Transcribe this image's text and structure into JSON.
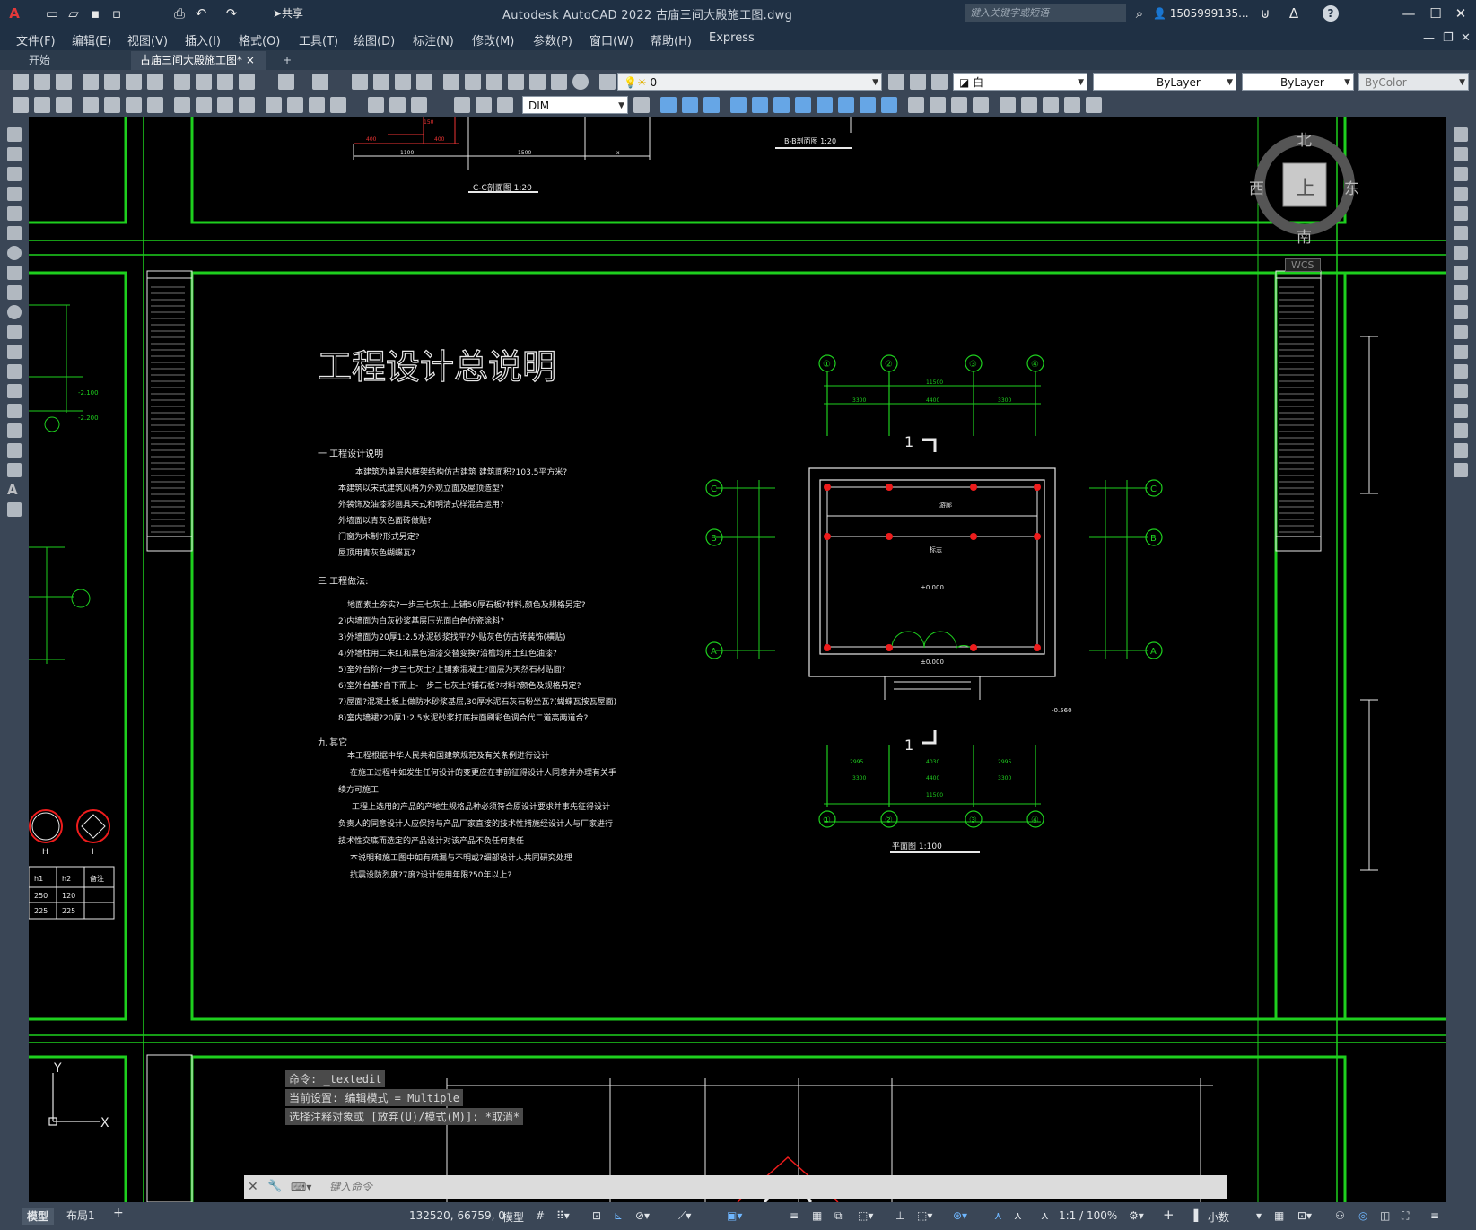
{
  "app": {
    "title": "Autodesk AutoCAD 2022    古庙三间大殿施工图.dwg",
    "share_label": "共享",
    "search_placeholder": "键入关键字或短语",
    "user": "1505999135...",
    "help": "?"
  },
  "menu": [
    "文件(F)",
    "编辑(E)",
    "视图(V)",
    "插入(I)",
    "格式(O)",
    "工具(T)",
    "绘图(D)",
    "标注(N)",
    "修改(M)",
    "参数(P)",
    "窗口(W)",
    "帮助(H)",
    "Express"
  ],
  "tabs": {
    "start": "开始",
    "active": "古庙三间大殿施工图*",
    "close": "×",
    "new": "+"
  },
  "toolbar": {
    "layer_value": "0",
    "color_value": "白",
    "linetype_value": "ByLayer",
    "lineweight_value": "ByLayer",
    "plotstyle_value": "ByColor",
    "dimstyle_value": "DIM"
  },
  "viewcube": {
    "north": "北",
    "south": "南",
    "east": "东",
    "west": "西",
    "top": "上",
    "wcs": "WCS"
  },
  "drawing": {
    "main_title": "工程设计总说明",
    "section1_head": "一 工程设计说明",
    "section1_lines": [
      "本建筑为单层内框架结构仿古建筑 建筑面积?103.5平方米?",
      "本建筑以宋式建筑风格为外观立面及屋顶造型?",
      "外装饰及油漆彩画具宋式和明清式样混合运用?",
      "外墙面以青灰色面砖做贴?",
      "门窗为木制?形式另定?",
      "屋顶用青灰色蝴蝶瓦?"
    ],
    "section2_head": "三 工程做法:",
    "section2_lines": [
      "地面素土夯实?一步三七灰土,上铺50厚石板?材料,颜色及规格另定?",
      "2)内墙面为白灰砂浆基层压光面白色仿瓷涂料?",
      "3)外墙面为20厚1:2.5水泥砂浆找平?外贴灰色仿古砖装饰(横贴)",
      "4)外墙柱用二朱红和黑色油漆交替变换?沿檐均用土红色油漆?",
      "5)室外台阶?一步三七灰土?上铺素混凝土?面层为天然石材贴面?",
      "6)室外台基?自下而上-一步三七灰土?铺石板?材料?颜色及规格另定?",
      "7)屋面?混凝土板上做防水砂浆基层,30厚水泥石灰石粉坐瓦?(蝴蝶瓦按瓦屋面)",
      "8)室内墙裙?20厚1:2.5水泥砂浆打底抹面刷彩色调合代二道高两道合?"
    ],
    "section3_head": "九 其它",
    "section3_lines": [
      "本工程根据中华人民共和国建筑规范及有关条例进行设计",
      "在施工过程中如发生任何设计的变更应在事前征得设计人同意并办理有关手",
      "续方可施工",
      "工程上选用的产品的产地生规格品种必须符合原设计要求并事先征得设计",
      "负责人的同意设计人应保持与产品厂家直接的技术性措施经设计人与厂家进行",
      "技术性交底而选定的产品设计对该产品不负任何责任",
      "本说明和施工图中如有疏漏与不明或?细部设计人共同研究处理",
      "抗震设防烈度?7度?设计使用年限?50年以上?"
    ],
    "section_cc": "C-C剖面图 1:20",
    "section_bb": "B-B剖面图 1:20",
    "plan_label": "平面图 1:100",
    "grid_top": [
      "①",
      "②",
      "③",
      "④"
    ],
    "grid_side": [
      "C",
      "B",
      "A"
    ],
    "dims_top": [
      "11500",
      "3300",
      "4400",
      "3300"
    ],
    "dims_bottom": [
      "2995",
      "4030",
      "2995",
      "3300",
      "4400",
      "3300",
      "11500"
    ],
    "elev": [
      "±0.000",
      "±0.000",
      "-0.560",
      "-2.100",
      "-2.200"
    ],
    "table": {
      "headers": [
        "h1",
        "h2",
        "备注"
      ],
      "rows": [
        [
          "250",
          "120",
          ""
        ],
        [
          "225",
          "225",
          ""
        ]
      ]
    },
    "circle_labels": [
      "H",
      "I"
    ],
    "section_marker": "1",
    "dims_cc": [
      "400",
      "150",
      "1100",
      "1500",
      "x"
    ]
  },
  "command": {
    "history": [
      "命令: _textedit",
      "当前设置: 编辑模式 = Multiple",
      "选择注释对象或 [放弃(U)/模式(M)]: *取消*"
    ],
    "placeholder": "键入命令"
  },
  "status": {
    "model_tab": "模型",
    "layout_tab": "布局1",
    "coords": "132520, 66759, 0",
    "space": "模型",
    "scale": "1:1 / 100%",
    "units": "小数",
    "add": "+"
  }
}
